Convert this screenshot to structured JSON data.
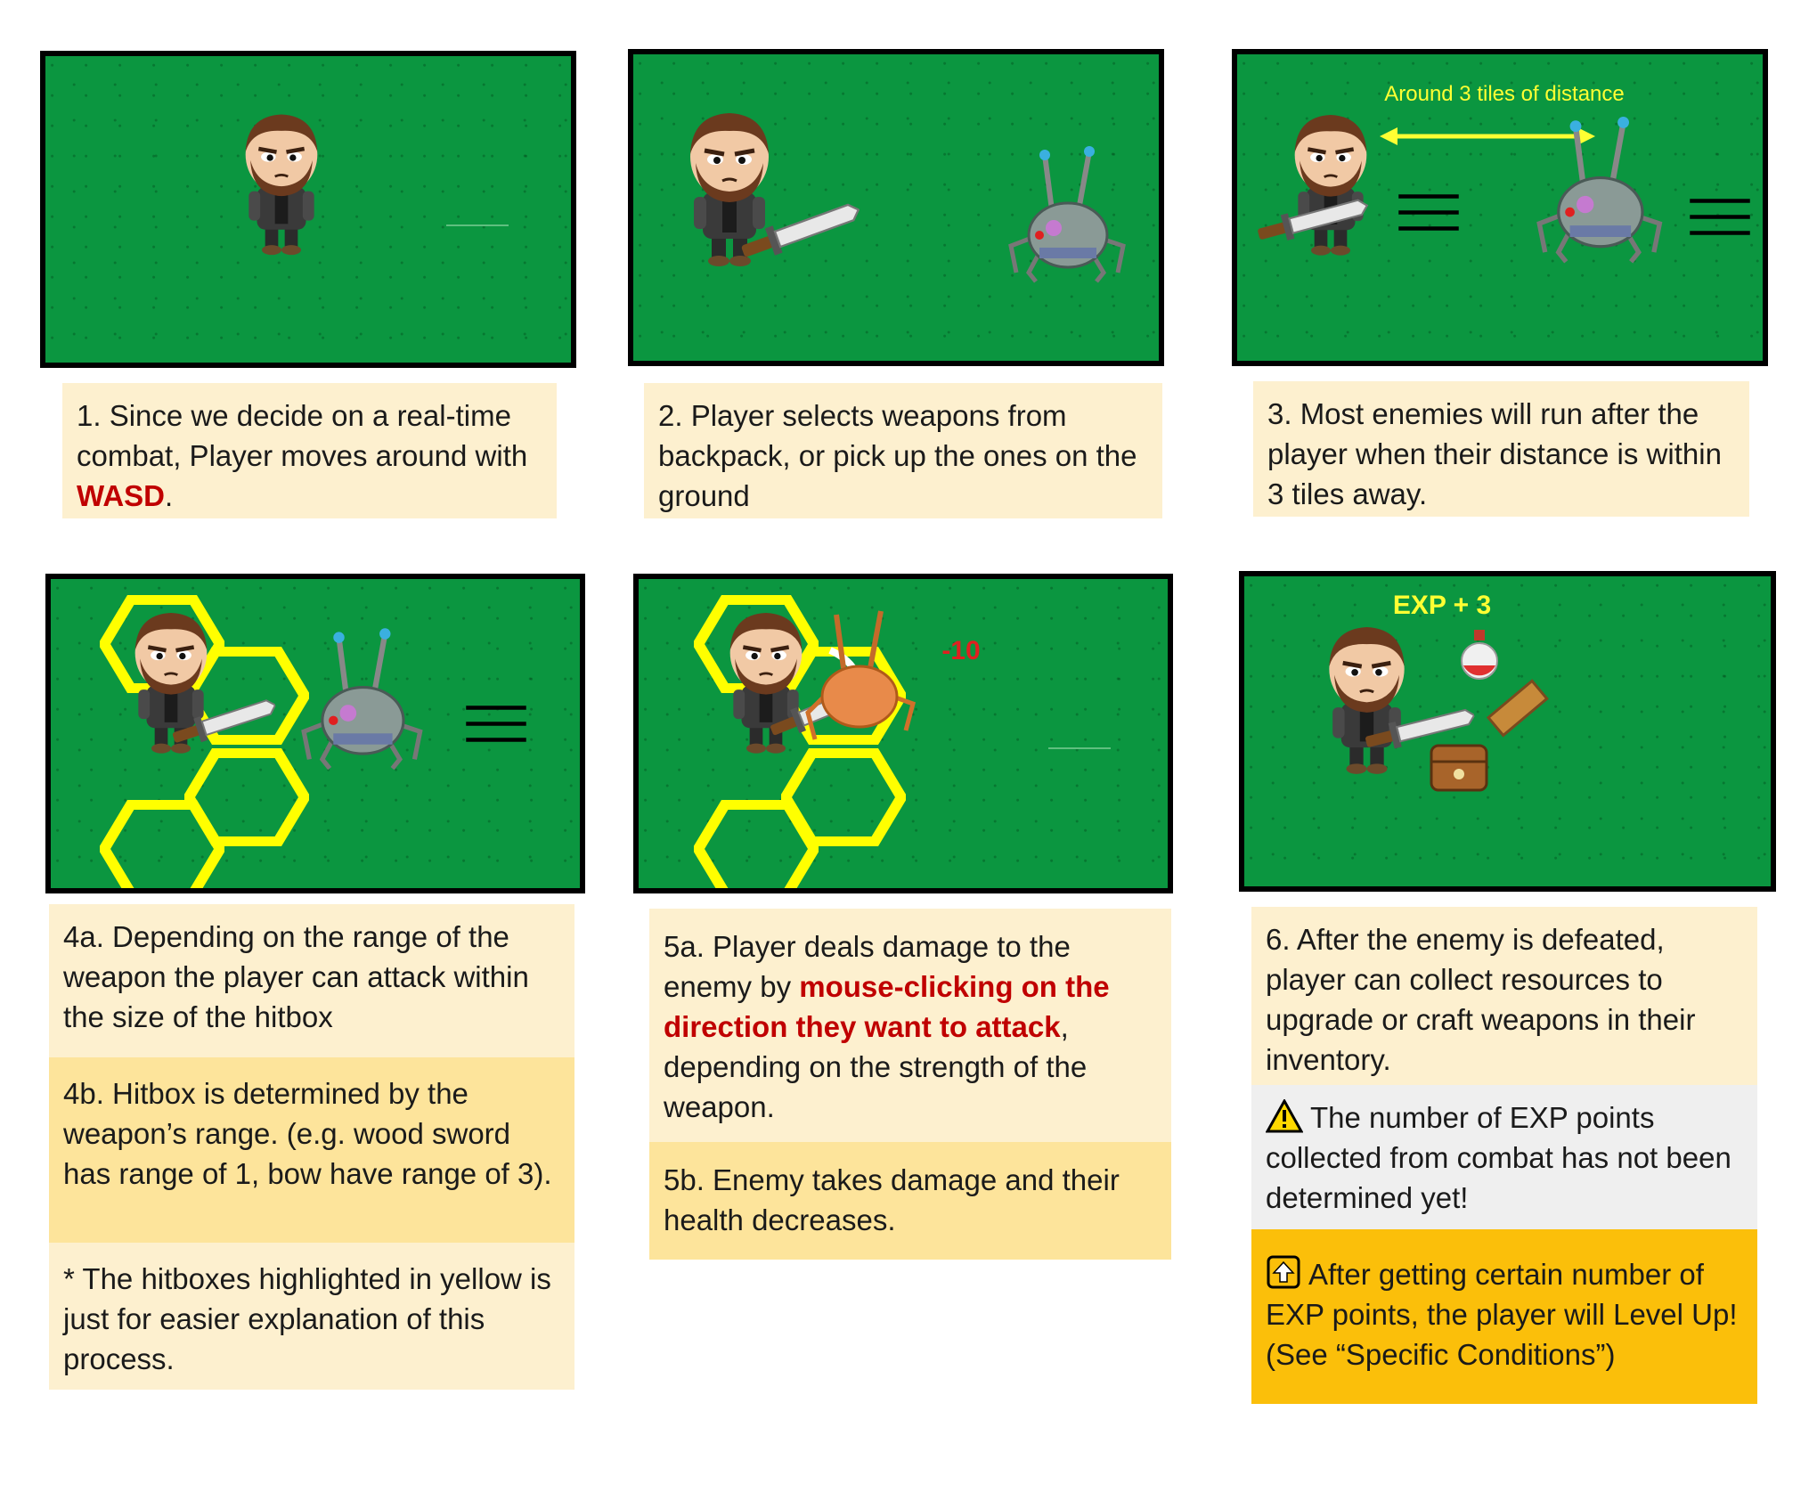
{
  "scenes": {
    "s3": {
      "distance_label": "Around 3 tiles of distance"
    },
    "s5": {
      "damage_label": "-10"
    },
    "s6": {
      "exp_label": "EXP + 3"
    }
  },
  "captions": {
    "c1": {
      "text_a": "1. Since we decide on a real-time combat, Player moves around with ",
      "highlight": "WASD",
      "text_b": "."
    },
    "c2": {
      "text": "2. Player selects weapons from backpack, or pick up the ones on the ground"
    },
    "c3": {
      "text": "3. Most enemies will run after the player when their distance is within 3 tiles away."
    },
    "c4a": {
      "text": "4a. Depending on the range of the weapon the player can attack within the size of the hitbox"
    },
    "c4b": {
      "text": "4b. Hitbox is determined by the weapon’s range. (e.g. wood sword has range of 1, bow have range of 3)."
    },
    "c4c": {
      "text": "* The hitboxes highlighted in yellow is just for easier explanation of this process."
    },
    "c5a": {
      "text_a": "5a.  Player deals damage to the enemy by ",
      "highlight": "mouse-clicking on the direction they want to attack",
      "text_b": ", depending on the strength of the weapon."
    },
    "c5b": {
      "text": "5b. Enemy takes damage and their health decreases."
    },
    "c6": {
      "text": "6.  After the enemy is defeated, player can collect resources to upgrade or craft weapons in their inventory."
    },
    "c6_warning": {
      "text": "The number of EXP points collected from combat has not been determined yet!"
    },
    "c6_levelup": {
      "text": "After getting certain number of EXP points, the player will Level Up! (See “Specific Conditions”)"
    }
  },
  "colors": {
    "grass": "#0b9640",
    "hitbox_yellow": "#ffff00",
    "label_yellow": "#ffff33",
    "highlight_red": "#c00000",
    "caption_light": "#fdf0cf",
    "caption_mid": "#fde49b",
    "caption_grey": "#efefef",
    "caption_gold": "#fbbf0a"
  },
  "icons": [
    "player-character-icon",
    "sword-icon",
    "spider-robot-enemy-icon",
    "motion-lines-icon",
    "potion-icon",
    "wood-plank-icon",
    "treasure-chest-icon",
    "warning-icon",
    "level-up-icon"
  ]
}
